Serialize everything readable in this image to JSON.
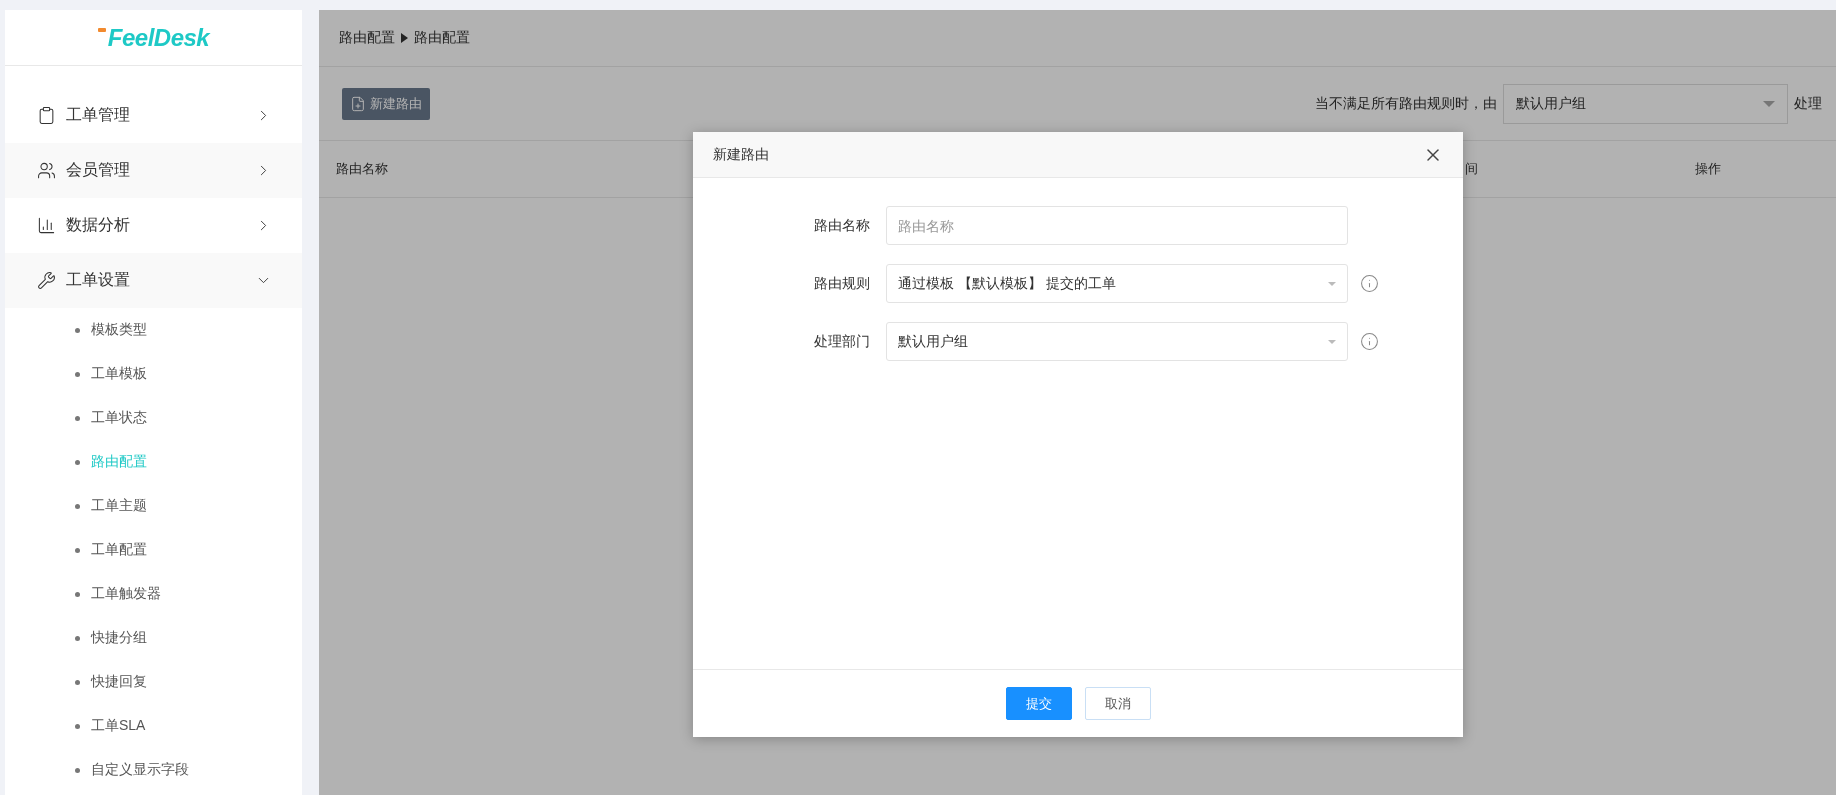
{
  "sidebar": {
    "logo": "FeelDesk",
    "menu": [
      {
        "label": "工单管理",
        "expanded": false
      },
      {
        "label": "会员管理",
        "expanded": false
      },
      {
        "label": "数据分析",
        "expanded": false
      },
      {
        "label": "工单设置",
        "expanded": true,
        "children": [
          {
            "label": "模板类型",
            "selected": false
          },
          {
            "label": "工单模板",
            "selected": false
          },
          {
            "label": "工单状态",
            "selected": false
          },
          {
            "label": "路由配置",
            "selected": true
          },
          {
            "label": "工单主题",
            "selected": false
          },
          {
            "label": "工单配置",
            "selected": false
          },
          {
            "label": "工单触发器",
            "selected": false
          },
          {
            "label": "快捷分组",
            "selected": false
          },
          {
            "label": "快捷回复",
            "selected": false
          },
          {
            "label": "工单SLA",
            "selected": false
          },
          {
            "label": "自定义显示字段",
            "selected": false
          }
        ]
      }
    ]
  },
  "breadcrumb": [
    "路由配置",
    "路由配置"
  ],
  "toolbar": {
    "new_button": "新建路由",
    "fallback_prefix": "当不满足所有路由规则时，由",
    "fallback_select": "默认用户组",
    "fallback_suffix": "处理"
  },
  "table": {
    "columns": [
      "路由名称",
      "间",
      "操作"
    ]
  },
  "dialog": {
    "title": "新建路由",
    "fields": [
      {
        "kind": "input",
        "label": "路由名称",
        "placeholder": "路由名称"
      },
      {
        "kind": "select",
        "label": "路由规则",
        "value": "通过模板 【默认模板】 提交的工单",
        "info": true
      },
      {
        "kind": "select",
        "label": "处理部门",
        "value": "默认用户组",
        "info": true
      }
    ],
    "buttons": [
      {
        "label": "提交",
        "primary": true
      },
      {
        "label": "取消",
        "primary": false
      }
    ]
  }
}
